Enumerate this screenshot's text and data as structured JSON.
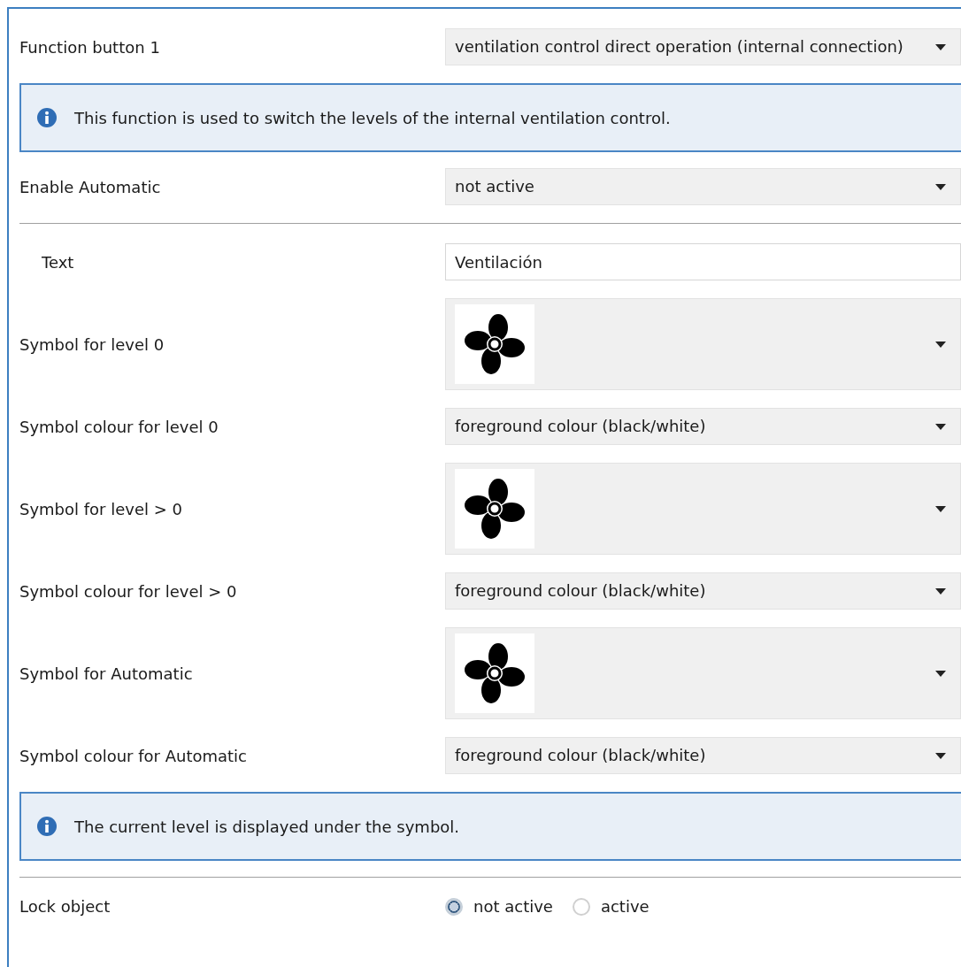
{
  "rows": [
    {
      "kind": "dropdown",
      "label": "Function button 1",
      "value": "ventilation control direct operation (internal connection)"
    },
    {
      "kind": "info",
      "text": "This function is used to switch the levels of the internal ventilation control."
    },
    {
      "kind": "dropdown",
      "label": "Enable Automatic",
      "value": "not active"
    },
    {
      "kind": "divider"
    },
    {
      "kind": "text",
      "label": "Text",
      "value": "Ventilación"
    },
    {
      "kind": "symbol",
      "label": "Symbol for level 0"
    },
    {
      "kind": "dropdown",
      "label": "Symbol colour for level 0",
      "value": "foreground colour (black/white)"
    },
    {
      "kind": "symbol",
      "label": "Symbol for level > 0"
    },
    {
      "kind": "dropdown",
      "label": "Symbol colour for level > 0",
      "value": "foreground colour (black/white)"
    },
    {
      "kind": "symbol",
      "label": "Symbol for Automatic"
    },
    {
      "kind": "dropdown",
      "label": "Symbol colour for Automatic",
      "value": "foreground colour (black/white)"
    },
    {
      "kind": "info",
      "text": "The current level is displayed under the symbol."
    },
    {
      "kind": "divider"
    },
    {
      "kind": "radio",
      "label": "Lock object",
      "options": [
        {
          "label": "not active",
          "selected": true
        },
        {
          "label": "active",
          "selected": false
        }
      ]
    }
  ]
}
